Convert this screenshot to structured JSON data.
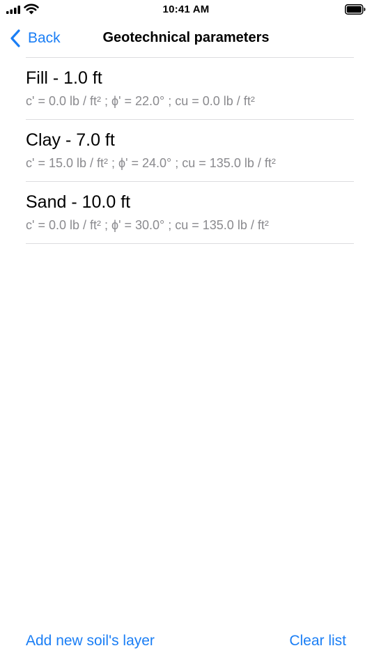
{
  "status_bar": {
    "time": "10:41 AM",
    "icons": [
      "cellular-signal-icon",
      "wifi-icon",
      "battery-icon"
    ]
  },
  "nav": {
    "back_label": "Back",
    "title": "Geotechnical parameters"
  },
  "layers": [
    {
      "title": "Fill - 1.0 ft",
      "params": "c' = 0.0 lb / ft² ; ϕ' = 22.0° ; cu = 0.0 lb / ft²"
    },
    {
      "title": "Clay - 7.0 ft",
      "params": "c' = 15.0 lb / ft² ; ϕ' = 24.0° ; cu = 135.0 lb / ft²"
    },
    {
      "title": "Sand - 10.0 ft",
      "params": "c' = 0.0 lb / ft² ; ϕ' = 30.0° ; cu = 135.0 lb / ft²"
    }
  ],
  "toolbar": {
    "add_label": "Add new soil's layer",
    "clear_label": "Clear list"
  },
  "colors": {
    "accent": "#1a7ef5",
    "secondary_text": "#8a8a8e",
    "separator": "#dcdcdf"
  }
}
